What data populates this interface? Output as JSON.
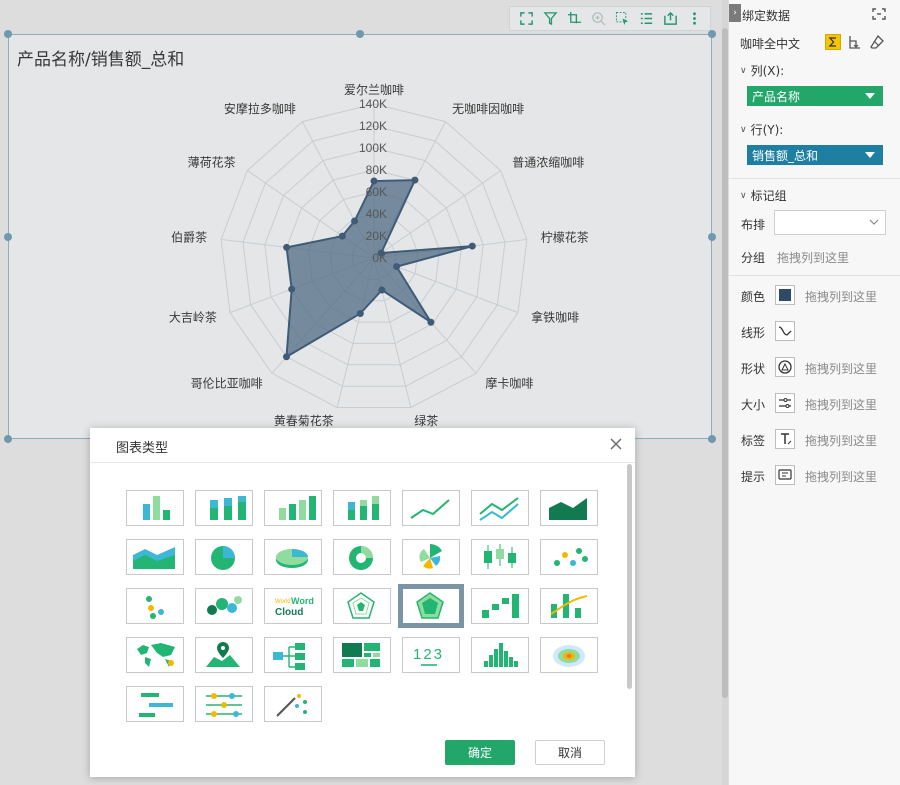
{
  "chart": {
    "title": "产品名称/销售额_总和",
    "tick_labels": [
      "0K",
      "20K",
      "40K",
      "60K",
      "80K",
      "100K",
      "120K",
      "140K"
    ],
    "colors": {
      "fill": "#4a6783",
      "stroke": "#3b5a78",
      "grid": "#d0d5d9"
    }
  },
  "chart_data": {
    "type": "radar",
    "categories": [
      "爱尔兰咖啡",
      "无咖啡因咖啡",
      "普通浓缩咖啡",
      "柠檬花茶",
      "拿铁咖啡",
      "摩卡咖啡",
      "绿茶",
      "黄春菊花茶",
      "哥伦比亚咖啡",
      "大吉岭茶",
      "伯爵茶",
      "薄荷花茶",
      "安摩拉多咖啡"
    ],
    "values": [
      70000,
      80000,
      8000,
      90000,
      22000,
      78000,
      30000,
      52000,
      120000,
      80000,
      80000,
      35000,
      38000
    ],
    "rlim": [
      0,
      140000
    ],
    "grid": true
  },
  "toolbar": {
    "buttons": [
      "fullscreen-icon",
      "filter-icon",
      "drill-icon",
      "zoom-icon",
      "select-icon",
      "list-icon",
      "export-icon",
      "more-icon"
    ]
  },
  "dialog": {
    "title": "图表类型",
    "ok_label": "确定",
    "cancel_label": "取消",
    "chart_types": [
      "column-chart",
      "stacked-column-chart",
      "3d-column-chart",
      "3d-stacked-column-chart",
      "line-chart",
      "multi-line-chart",
      "area-chart",
      "stacked-area-chart",
      "pie-chart",
      "3d-pie-chart",
      "donut-chart",
      "rose-chart",
      "box-plot",
      "scatter-chart",
      "scatter-color-chart",
      "bubble-chart",
      "word-cloud",
      "radar-chart",
      "filled-radar-chart",
      "waterfall-chart",
      "combo-chart",
      "world-map",
      "location-map",
      "tree-chart",
      "treemap",
      "kpi-number",
      "histogram",
      "heat-map",
      "gantt-chart",
      "timeline-chart",
      "wand-chart"
    ],
    "selected": "filled-radar-chart",
    "wordcloud_text": {
      "small": "World",
      "line1": "Word",
      "line2": "Cloud"
    },
    "kpi_text": "123"
  },
  "panel": {
    "title": "绑定数据",
    "dataset": "咖啡全中文",
    "columns_label": "列(X):",
    "column_field": "产品名称",
    "rows_label": "行(Y):",
    "row_field": "销售额_总和",
    "marks_label": "标记组",
    "layout_label": "布排",
    "group_label": "分组",
    "group_hint": "拖拽列到这里",
    "props": [
      {
        "label": "颜色",
        "hint": "拖拽列到这里"
      },
      {
        "label": "线形",
        "hint": ""
      },
      {
        "label": "形状",
        "hint": "拖拽列到这里"
      },
      {
        "label": "大小",
        "hint": "拖拽列到这里"
      },
      {
        "label": "标签",
        "hint": "拖拽列到这里"
      },
      {
        "label": "提示",
        "hint": "拖拽列到这里"
      }
    ],
    "colors": {
      "column_pill": "#22a66a",
      "row_pill": "#1f7fa3",
      "accent": "#e3a700"
    }
  }
}
